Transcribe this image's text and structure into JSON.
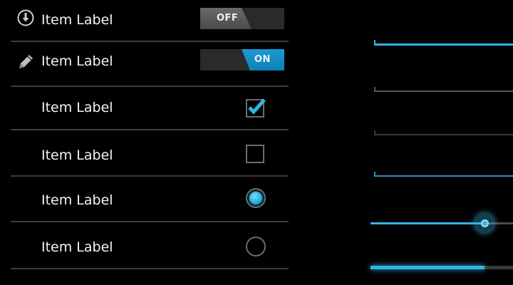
{
  "list": {
    "rows": [
      {
        "label": "Item Label",
        "icon": "download-icon",
        "control": "toggle",
        "state": "OFF"
      },
      {
        "label": "Item Label",
        "icon": "pencil-icon",
        "control": "toggle",
        "state": "ON"
      },
      {
        "label": "Item Label",
        "control": "checkbox",
        "checked": true
      },
      {
        "label": "Item Label",
        "control": "checkbox",
        "checked": false
      },
      {
        "label": "Item Label",
        "control": "radio",
        "selected": true
      },
      {
        "label": "Item Label",
        "control": "radio",
        "selected": false
      }
    ]
  },
  "right_panel": {
    "seekbar": {
      "value": 0.8
    },
    "progress": {
      "value": 0.8
    }
  },
  "colors": {
    "accent": "#33b5e5",
    "accent_dark": "#0f7fb3",
    "background": "#000000",
    "divider": "#3c3c3c",
    "control_border": "#6b6b6b",
    "text": "#f4f4f4"
  }
}
